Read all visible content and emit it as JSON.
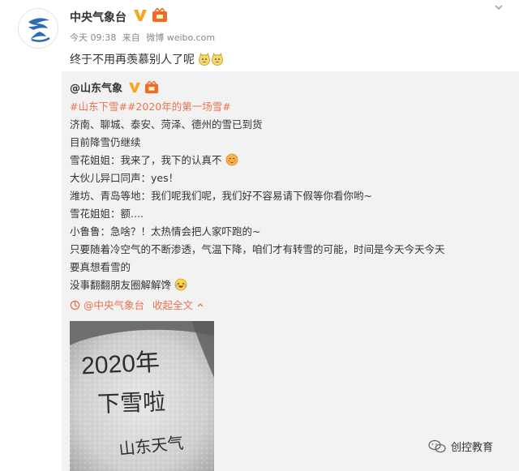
{
  "post": {
    "author": "中央气象台",
    "time": "今天 09:38",
    "from_prefix": "来自",
    "source": "微博 weibo.com",
    "text": "终于不用再羡慕别人了呢"
  },
  "repost": {
    "author": "@山东气象",
    "tags": [
      "#山东下雪#",
      "#2020年的第一场雪#"
    ],
    "lines": [
      "济南、聊城、泰安、菏泽、德州的雪已到货",
      "目前降雪仍继续",
      "雪花姐姐：我来了，我下的认真不",
      "大伙儿异口同声：yes！",
      "潍坊、青岛等地：我们呢我们呢，我们好不容易请下假等你看你哟~",
      "雪花姐姐：额....",
      "小鲁鲁：急啥？！太热情会把人家吓跑的~",
      "只要随着冷空气的不断渗透，气温下降，咱们才有转雪的可能，时间是今天今天今天",
      "要真想看雪的",
      "没事翻翻朋友圈解解馋"
    ],
    "via": "@中央气象台",
    "collapse": "收起全文"
  },
  "photo": {
    "line1": "2020年",
    "line2": "下雪啦",
    "line3": "山东天气"
  },
  "watermark": "创控教育",
  "colors": {
    "accent": "#eb7350",
    "verified": "#f5a623",
    "link_blue": "#eb7350",
    "repost_bg": "#f2f2f2"
  }
}
